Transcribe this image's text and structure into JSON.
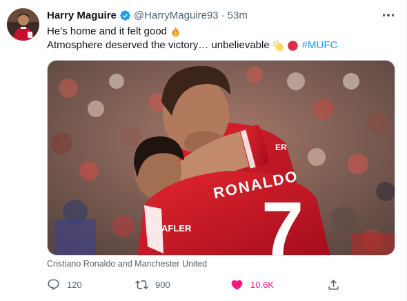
{
  "tweet": {
    "author_name": "Harry Maguire",
    "handle": "@HarryMaguire93",
    "separator": "·",
    "time": "53m",
    "line1": "He’s home and it felt good",
    "line2": "Atmosphere deserved the victory… unbelievable",
    "hashtag": "#MUFC",
    "line1_emoji": "fire-emoji",
    "line2_emojis": [
      "clapping-hands-emoji",
      "red-circle-emoji"
    ],
    "media_caption": "Cristiano Ronaldo and Manchester United",
    "jersey_name": "RONALDO",
    "jersey_number": "7",
    "sleeve_text": "AFLER",
    "kit_text": "ER"
  },
  "stats": {
    "replies": "120",
    "retweets": "900",
    "likes": "10.6K"
  },
  "icons": {
    "reply": "reply-icon",
    "retweet": "retweet-icon",
    "like": "heart-icon",
    "share": "share-icon",
    "more": "more-icon",
    "verified": "verified-badge-icon"
  },
  "colors": {
    "accent": "#1d9bf0",
    "like": "#f91880",
    "muted": "#536471",
    "text": "#0f1419",
    "jersey_red": "#c8102e"
  }
}
